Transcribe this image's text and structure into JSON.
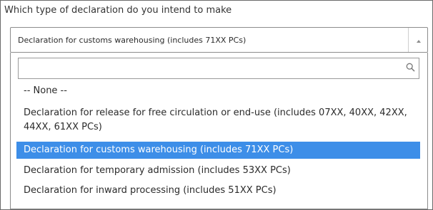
{
  "question": "Which type of declaration do you intend to make",
  "select": {
    "value": "Declaration for customs warehousing (includes 71XX PCs)"
  },
  "search": {
    "value": "",
    "placeholder": ""
  },
  "options": [
    {
      "label": "-- None --",
      "selected": false
    },
    {
      "label": "Declaration for release for free circulation or end-use (includes 07XX, 40XX, 42XX, 44XX, 61XX PCs)",
      "selected": false
    },
    {
      "label": "Declaration for customs warehousing (includes 71XX PCs)",
      "selected": true
    },
    {
      "label": "Declaration for temporary admission (includes 53XX PCs)",
      "selected": false
    },
    {
      "label": "Declaration for inward processing (includes 51XX PCs)",
      "selected": false
    }
  ],
  "colors": {
    "selected_bg": "#3d8ee8",
    "selected_text": "#ffffff",
    "border": "#8c8c8c"
  },
  "icons": {
    "select_caret": "caret-up-icon",
    "search": "search-icon"
  }
}
